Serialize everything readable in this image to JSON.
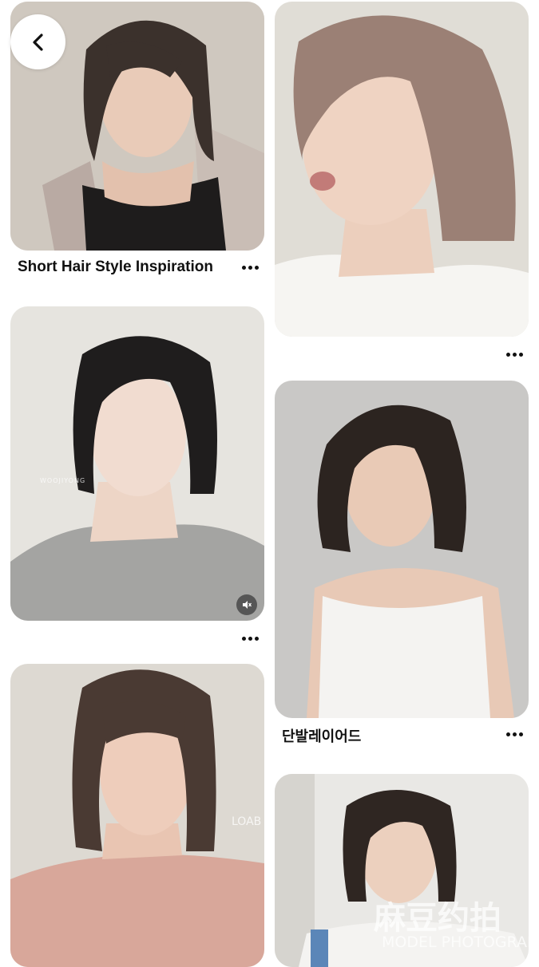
{
  "nav": {
    "back_icon": "chevron-left-icon"
  },
  "pins": [
    {
      "title": "Short Hair Style Inspiration",
      "more_icon": "more-horizontal-icon"
    },
    {
      "title": "",
      "more_icon": "more-horizontal-icon"
    },
    {
      "title": "",
      "more_icon": "more-horizontal-icon",
      "badge_icon": "mute-icon"
    },
    {
      "title": "단발레이어드",
      "more_icon": "more-horizontal-icon"
    },
    {
      "title": ""
    },
    {
      "title": ""
    }
  ],
  "watermarks": {
    "pin5_corner": "LOAB",
    "pin3_side": "WOOJIYONG",
    "pin6_brand": "麻豆约拍",
    "pin6_sub": "MODEL PHOTOGRAPHY"
  },
  "colors": {
    "text": "#111111",
    "background": "#ffffff",
    "card_bg": "#e7e3dd"
  }
}
